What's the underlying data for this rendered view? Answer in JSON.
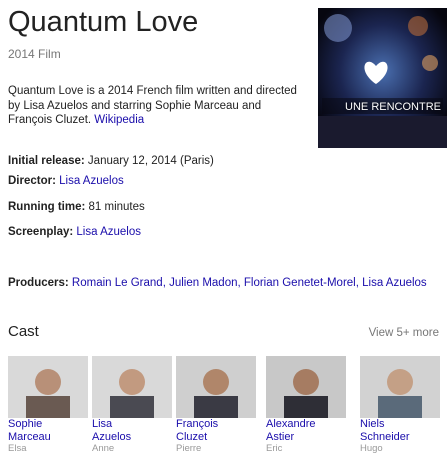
{
  "entity": {
    "title": "Quantum Love",
    "subtitle": "2014 Film"
  },
  "poster": {
    "caption": "UNE RENCONTRE"
  },
  "description": {
    "text": "Quantum Love is a 2014 French film written and directed by Lisa Azuelos and starring Sophie Marceau and François Cluzet.",
    "source": "Wikipedia"
  },
  "facts": {
    "release_label": "Initial release:",
    "release_value": "January 12, 2014 (Paris)",
    "director_label": "Director:",
    "director_value": "Lisa Azuelos",
    "runtime_label": "Running time:",
    "runtime_value": "81 minutes",
    "screenplay_label": "Screenplay:",
    "screenplay_value": "Lisa Azuelos",
    "producers_label": "Producers:",
    "producers_value": "Romain Le Grand, Julien Madon, Florian Genetet-Morel, Lisa Azuelos"
  },
  "cast": {
    "heading": "Cast",
    "more_label": "View 5+ more",
    "members": [
      {
        "first": "Sophie",
        "last": "Marceau",
        "role": "Elsa"
      },
      {
        "first": "Lisa",
        "last": "Azuelos",
        "role": "Anne"
      },
      {
        "first": "François",
        "last": "Cluzet",
        "role": "Pierre"
      },
      {
        "first": "Alexandre",
        "last": "Astier",
        "role": "Eric"
      },
      {
        "first": "Niels",
        "last": "Schneider",
        "role": "Hugo"
      }
    ]
  }
}
